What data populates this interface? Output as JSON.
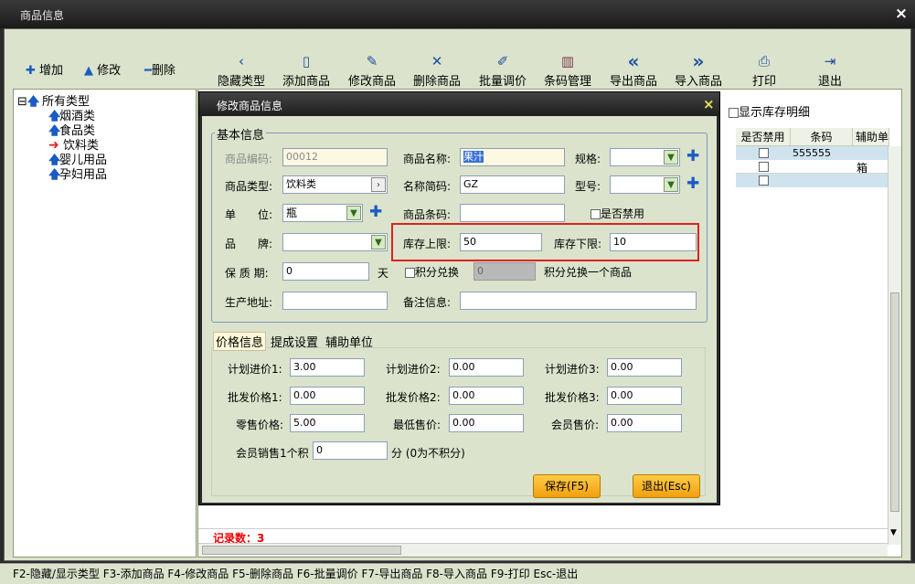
{
  "window": {
    "title": "商品信息",
    "close": "×"
  },
  "toolbar": {
    "add": "增加",
    "edit": "修改",
    "del": "删除",
    "items": [
      {
        "label": "隐藏类型",
        "icon": "‹"
      },
      {
        "label": "添加商品",
        "icon": "▯"
      },
      {
        "label": "修改商品",
        "icon": "✎"
      },
      {
        "label": "删除商品",
        "icon": "✕"
      },
      {
        "label": "批量调价",
        "icon": "✐"
      },
      {
        "label": "条码管理",
        "icon": "▥"
      },
      {
        "label": "导出商品",
        "icon": "«"
      },
      {
        "label": "导入商品",
        "icon": "»"
      },
      {
        "label": "打印",
        "icon": "⎙"
      },
      {
        "label": "退出",
        "icon": "⇥"
      }
    ]
  },
  "tree": {
    "expander": "⊟",
    "root": "所有类型",
    "children": [
      "烟酒类",
      "食品类",
      "饮料类",
      "婴儿用品",
      "孕妇用品"
    ],
    "selected": "饮料类"
  },
  "grid": {
    "show_stock": "显示库存明细",
    "headers": [
      "是否禁用",
      "条码",
      "辅助单"
    ],
    "rows": [
      {
        "barcode": "555555",
        "unit": ""
      },
      {
        "barcode": "",
        "unit": "箱"
      },
      {
        "barcode": "",
        "unit": ""
      }
    ],
    "record_count": "记录数：3"
  },
  "dialog": {
    "title": "修改商品信息",
    "close": "×",
    "group": "基本信息",
    "labels": {
      "code": "商品编码:",
      "name": "商品名称:",
      "spec": "规格:",
      "type": "商品类型:",
      "short": "名称简码:",
      "model": "型号:",
      "unit": "单　　位:",
      "barcode": "商品条码:",
      "disabled": "是否禁用",
      "brand": "品　　牌:",
      "max": "库存上限:",
      "min": "库存下限:",
      "shelf": "保 质 期:",
      "day": "天",
      "points": "积分兑换",
      "points_tip": "积分兑换一个商品",
      "origin": "生产地址:",
      "remark": "备注信息:"
    },
    "values": {
      "code": "00012",
      "name": "果汁",
      "type": "饮料类",
      "short": "GZ",
      "unit": "瓶",
      "max": "50",
      "min": "10",
      "shelf": "0",
      "points": "0"
    },
    "tabs": [
      "价格信息",
      "提成设置",
      "辅助单位"
    ],
    "prices": {
      "labels": [
        "计划进价1:",
        "计划进价2:",
        "计划进价3:",
        "批发价格1:",
        "批发价格2:",
        "批发价格3:",
        "零售价格:",
        "最低售价:",
        "会员售价:"
      ],
      "values": [
        "3.00",
        "0.00",
        "0.00",
        "0.00",
        "0.00",
        "0.00",
        "5.00",
        "0.00",
        "0.00"
      ],
      "member_label": "会员销售1个积",
      "member_value": "0",
      "member_tip": "分 (0为不积分)"
    },
    "save": "保存(F5)",
    "exit": "退出(Esc)"
  },
  "status": "F2-隐藏/显示类型  F3-添加商品 F4-修改商品 F5-删除商品 F6-批量调价 F7-导出商品 F8-导入商品 F9-打印 Esc-退出",
  "colors": {
    "highlight": "#e02020",
    "accent": "#1a5bc4"
  }
}
